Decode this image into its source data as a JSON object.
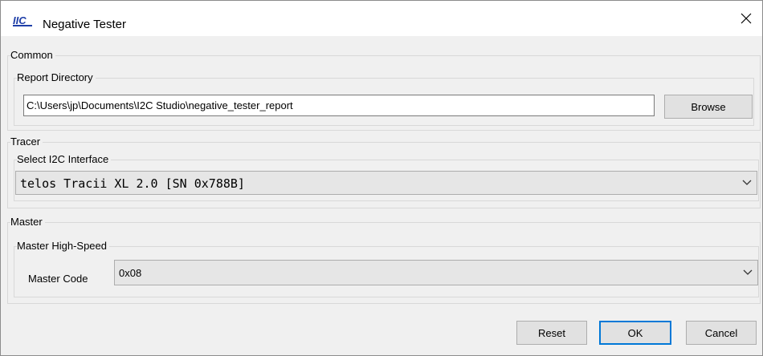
{
  "window": {
    "title": "Negative Tester",
    "logo_text": "IIC",
    "close_symbol": "✕"
  },
  "common": {
    "label": "Common",
    "report_directory": {
      "label": "Report Directory",
      "path": "C:\\Users\\jp\\Documents\\I2C Studio\\negative_tester_report",
      "browse_label": "Browse"
    }
  },
  "tracer": {
    "label": "Tracer",
    "select_interface": {
      "label": "Select I2C Interface",
      "selected": "telos Tracii XL 2.0 [SN 0x788B]"
    }
  },
  "master": {
    "label": "Master",
    "high_speed": {
      "label": "Master High-Speed",
      "code_label": "Master Code",
      "code_value": "0x08"
    }
  },
  "footer": {
    "reset_label": "Reset",
    "ok_label": "OK",
    "cancel_label": "Cancel"
  },
  "colors": {
    "accent": "#0078d7",
    "logo": "#1f3fa8"
  },
  "icons": [
    "app-logo-icon",
    "close-icon",
    "chevron-down-icon"
  ]
}
